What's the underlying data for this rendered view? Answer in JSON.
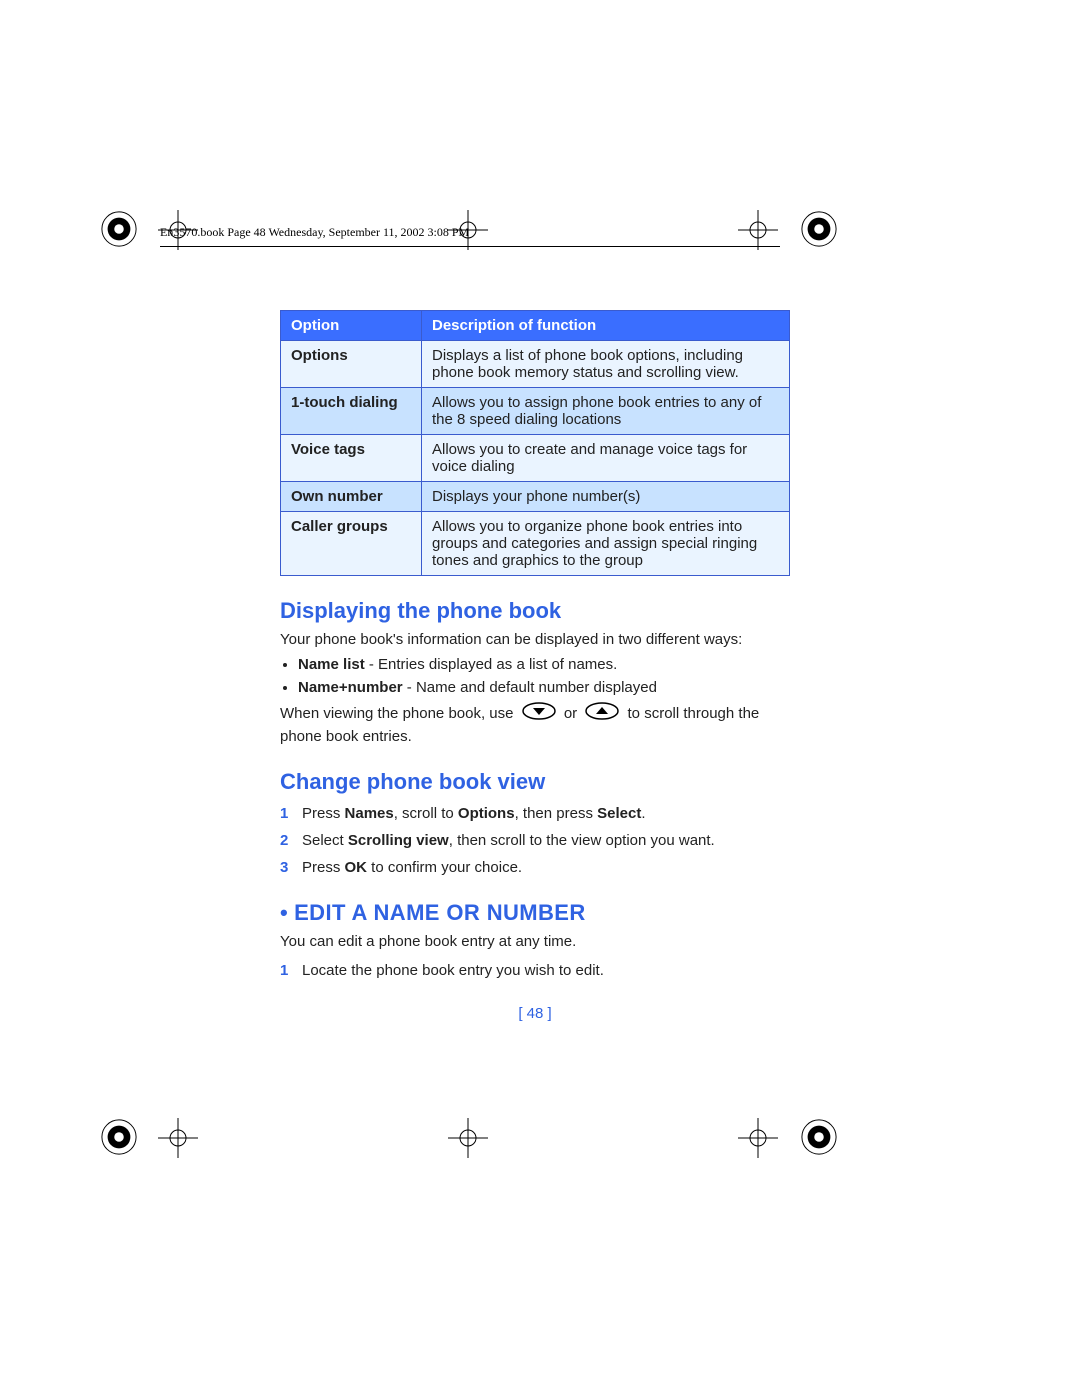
{
  "running_head": "En3570.book  Page 48  Wednesday, September 11, 2002  3:08 PM",
  "table": {
    "head": {
      "option": "Option",
      "desc": "Description of function"
    },
    "rows": [
      {
        "option": "Options",
        "desc": "Displays a list of phone book options, including phone book memory status and scrolling view."
      },
      {
        "option": "1-touch dialing",
        "desc": "Allows you to assign phone book entries to any of the 8 speed dialing locations"
      },
      {
        "option": "Voice tags",
        "desc": "Allows you to create and manage voice tags for voice dialing"
      },
      {
        "option": "Own number",
        "desc": "Displays your phone number(s)"
      },
      {
        "option": "Caller groups",
        "desc": "Allows you to organize phone book entries into groups and categories and assign special ringing tones and graphics to the group"
      }
    ]
  },
  "section1": {
    "heading": "Displaying the phone book",
    "intro": "Your phone book's information can be displayed in two different ways:",
    "bullets": [
      {
        "bold": "Name list",
        "rest": " - Entries displayed as a list of names."
      },
      {
        "bold": "Name+number",
        "rest": " - Name and default number displayed"
      }
    ],
    "scroll_pre": "When viewing the phone book, use ",
    "scroll_mid": " or ",
    "scroll_post": " to scroll through the phone book entries."
  },
  "section2": {
    "heading": "Change phone book view",
    "steps": [
      {
        "num": "1",
        "parts": [
          "Press ",
          "Names",
          ", scroll to ",
          "Options",
          ", then press ",
          "Select",
          "."
        ]
      },
      {
        "num": "2",
        "parts": [
          "Select ",
          "Scrolling view",
          ", then scroll to the view option you want."
        ]
      },
      {
        "num": "3",
        "parts": [
          "Press ",
          "OK",
          " to confirm your choice."
        ]
      }
    ]
  },
  "section3": {
    "bullet": "•",
    "heading": "EDIT A NAME OR NUMBER",
    "intro": "You can edit a phone book entry at any time.",
    "steps": [
      {
        "num": "1",
        "text": "Locate the phone book entry you wish to edit."
      }
    ]
  },
  "page_number": "[ 48 ]"
}
